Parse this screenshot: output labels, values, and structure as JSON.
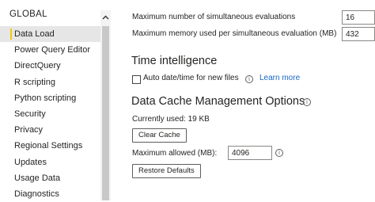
{
  "sidebar": {
    "header": "GLOBAL",
    "items": [
      {
        "label": "Data Load",
        "selected": true
      },
      {
        "label": "Power Query Editor"
      },
      {
        "label": "DirectQuery"
      },
      {
        "label": "R scripting"
      },
      {
        "label": "Python scripting"
      },
      {
        "label": "Security"
      },
      {
        "label": "Privacy"
      },
      {
        "label": "Regional Settings"
      },
      {
        "label": "Updates"
      },
      {
        "label": "Usage Data"
      },
      {
        "label": "Diagnostics"
      }
    ]
  },
  "evaluations": {
    "max_simultaneous_label": "Maximum number of simultaneous evaluations",
    "max_simultaneous_value": "16",
    "max_memory_label": "Maximum memory used per simultaneous evaluation (MB)",
    "max_memory_value": "432"
  },
  "time_intelligence": {
    "title": "Time intelligence",
    "checkbox_label": "Auto date/time for new files",
    "checked": false,
    "learn_more": "Learn more"
  },
  "data_cache": {
    "title": "Data Cache Management Options",
    "currently_used": "Currently used: 19 KB",
    "clear_cache_button": "Clear Cache",
    "max_allowed_label": "Maximum allowed (MB):",
    "max_allowed_value": "4096",
    "restore_defaults_button": "Restore Defaults"
  },
  "icons": {
    "info": "info-icon",
    "scroll_up": "chevron-up-icon"
  },
  "colors": {
    "accent_selected": "#f2c811",
    "link": "#1a66c7",
    "selected_bg": "#e6e6e6"
  }
}
